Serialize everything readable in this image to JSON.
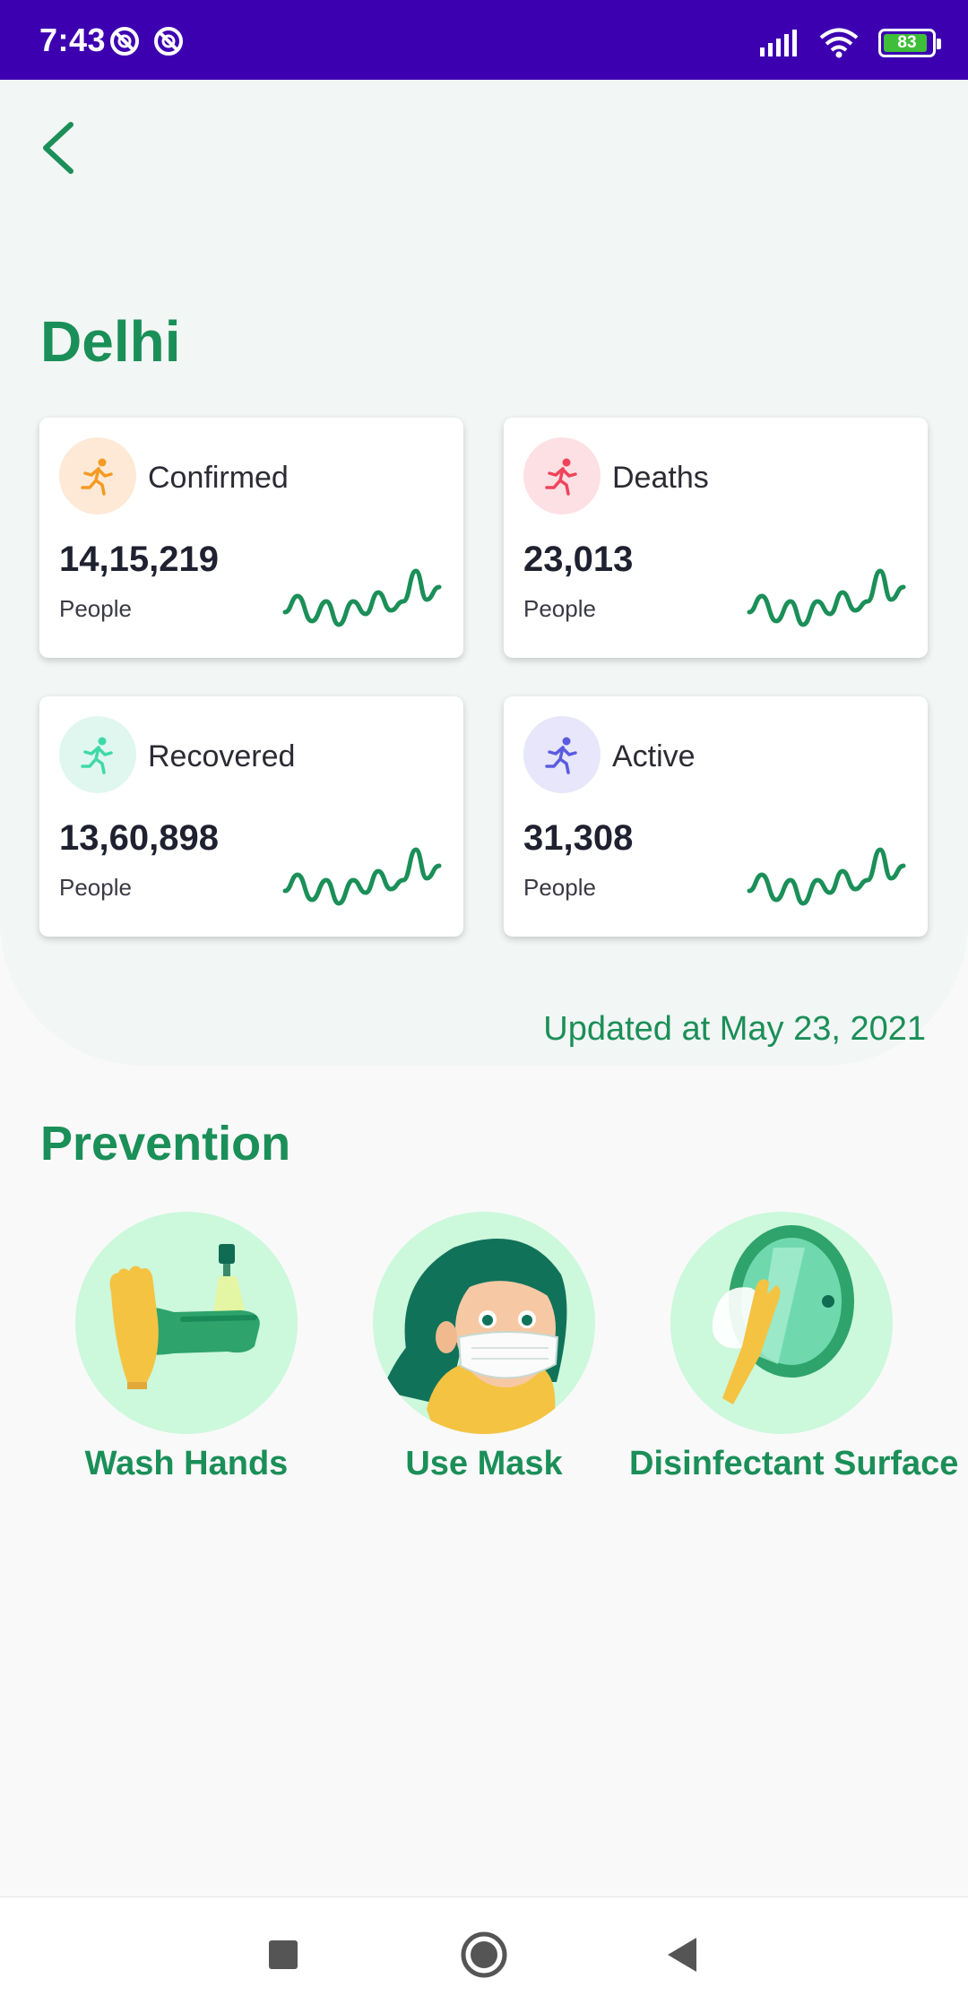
{
  "status_bar": {
    "time": "7:43",
    "battery_level": "83",
    "icons": [
      "do-not-disturb-icon",
      "do-not-disturb-icon",
      "cellular-signal-icon",
      "wifi-icon",
      "battery-icon"
    ]
  },
  "header": {
    "back_icon": "chevron-left-icon",
    "title": "Delhi"
  },
  "stats": [
    {
      "label": "Confirmed",
      "value": "14,15,219",
      "unit": "People",
      "icon": "running-person-icon",
      "color": "#f59a23",
      "icon_bg": "#fde9d6"
    },
    {
      "label": "Deaths",
      "value": "23,013",
      "unit": "People",
      "icon": "running-person-icon",
      "color": "#f0445c",
      "icon_bg": "#fde0e4"
    },
    {
      "label": "Recovered",
      "value": "13,60,898",
      "unit": "People",
      "icon": "running-person-icon",
      "color": "#3fd9a8",
      "icon_bg": "#dff7ef"
    },
    {
      "label": "Active",
      "value": "31,308",
      "unit": "People",
      "icon": "running-person-icon",
      "color": "#5b5be0",
      "icon_bg": "#e7e6fa"
    }
  ],
  "updated_text": "Updated at May 23, 2021",
  "prevention": {
    "title": "Prevention",
    "items": [
      {
        "label": "Wash Hands",
        "icon": "wash-hands-illustration"
      },
      {
        "label": "Use Mask",
        "icon": "mask-person-illustration"
      },
      {
        "label": "Disinfectant Surface",
        "icon": "disinfect-surface-illustration"
      }
    ]
  },
  "nav_bar": {
    "icons": [
      "recents-square-icon",
      "home-circle-icon",
      "back-triangle-icon"
    ]
  },
  "colors": {
    "accent": "#1b8f58",
    "status_bar": "#3d00b1",
    "sparkline": "#1b8f58"
  }
}
